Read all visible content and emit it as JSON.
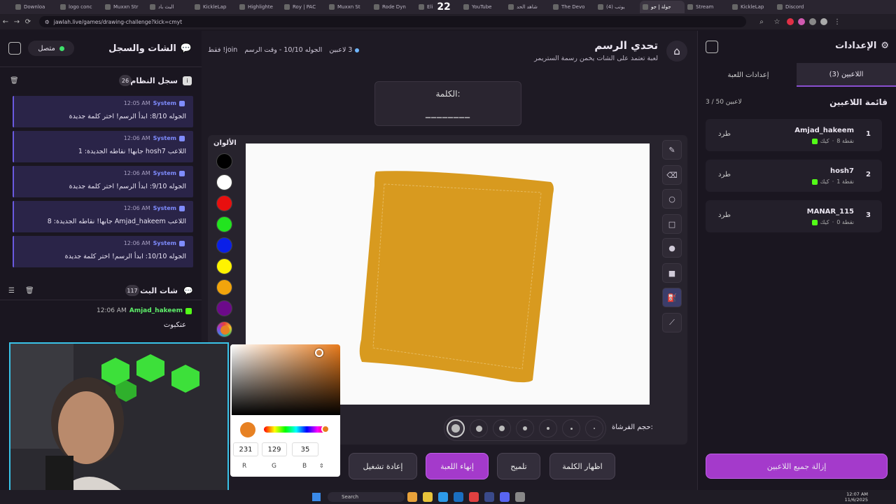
{
  "browser": {
    "tabs": [
      "Downloa",
      "logo conc",
      "Muxxn Str",
      "البث باد",
      "KickleLap",
      "Highlighte",
      "Roy | PAC",
      "Muxxn St",
      "Rode Dyn",
      "Eli",
      "YouTube",
      "شاهد الحد",
      "The Devo",
      "(4) يوتب",
      "جولة | جو",
      "Stream",
      "KickleLap",
      "Discord"
    ],
    "badge_count": "22",
    "url": "jawlah.live/games/drawing-challenge?kick=cmyt"
  },
  "left": {
    "title": "الشات والسجل",
    "status": "متصل",
    "system_log": {
      "title": "سجل النظام",
      "count": "26"
    },
    "messages": [
      {
        "sender": "System",
        "time": "12:05 AM",
        "text": "الجوله 8/10: ابدأ الرسم! اختر كلمة جديدة"
      },
      {
        "sender": "System",
        "time": "12:06 AM",
        "text": "اللاعب hosh7 جابها! نقاطه الجديدة: 1"
      },
      {
        "sender": "System",
        "time": "12:06 AM",
        "text": "الجوله 9/10: ابدأ الرسم! اختر كلمة جديدة"
      },
      {
        "sender": "System",
        "time": "12:06 AM",
        "text": "اللاعب Amjad_hakeem جابها! نقاطه الجديدة: 8"
      },
      {
        "sender": "System",
        "time": "12:06 AM",
        "text": "الجوله 10/10: ابدأ الرسم! اختر كلمة جديدة"
      }
    ],
    "stream_chat": {
      "title": "شات البث",
      "count": "117"
    },
    "chat_messages": [
      {
        "user": "Amjad_hakeem",
        "time": "12:06 AM",
        "text": "عنكبوت"
      }
    ]
  },
  "header": {
    "title": "تحدي الرسم",
    "subtitle": "لعبة تعتمد على الشات يخمن رسمة الستريمر",
    "players_count": "3 لاعبين",
    "round_info": "الجوله 10/10 - وقت الرسم",
    "join_only": "join! فقط"
  },
  "word": {
    "label": "الكلمة:",
    "masked": "________"
  },
  "colors": {
    "label": "الألوان",
    "swatches": [
      "#000000",
      "#ffffff",
      "#e80f0f",
      "#22e41f",
      "#0a1fe8",
      "#fff300",
      "#f2a40c",
      "#6c0a8a"
    ]
  },
  "canvas": {
    "fill_color": "#d89a1f"
  },
  "brush": {
    "label": "حجم الفرشاة:"
  },
  "picker": {
    "r": "231",
    "g": "129",
    "b": "35",
    "r_label": "R",
    "g_label": "G",
    "b_label": "B",
    "swatch": "#e78123"
  },
  "buttons": {
    "restart": "إعادة تشغيل",
    "end_game": "إنهاء اللعبة",
    "hint": "تلميح",
    "show_word": "اظهار الكلمة"
  },
  "right": {
    "title": "الإعدادات",
    "tab_players": "اللاعبين (3)",
    "tab_settings": "إعدادات اللعبة",
    "list_title": "قائمة اللاعبين",
    "list_count": "3 / 50 لاعبين",
    "kick_label": "طرد",
    "players": [
      {
        "rank": "1",
        "name": "Amjad_hakeem",
        "points": "8 نقطة",
        "platform": "كيك"
      },
      {
        "rank": "2",
        "name": "hosh7",
        "points": "1 نقطة",
        "platform": "كيك"
      },
      {
        "rank": "3",
        "name": "MANAR_115",
        "points": "0 نقطة",
        "platform": "كيك"
      }
    ],
    "remove_all": "إزالة جميع اللاعبين"
  },
  "taskbar": {
    "search": "Search",
    "time": "12:07 AM",
    "date": "11/6/2025"
  }
}
